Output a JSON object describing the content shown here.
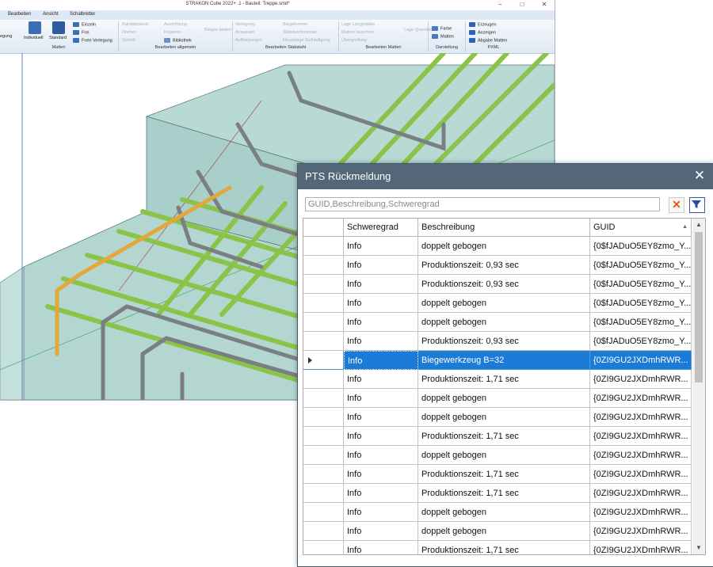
{
  "app": {
    "title": "STRAKON Cube 2022+ .1 - Bauteil: Treppe.smd*",
    "window_controls": [
      "–",
      "□",
      "✕"
    ],
    "ribbon_tabs": [
      "Bearbeiten",
      "Ansicht",
      "Schalbretter"
    ],
    "ribbon_groups": [
      "Matten",
      "Bearbeiten allgemein",
      "Bearbeiten Stabstahl",
      "Bearbeiten Matten",
      "Darstellung",
      "PXML"
    ],
    "ribbon": {
      "matten_big": [
        "Individuell",
        "Standard"
      ],
      "matten_small": [
        "Einzeln",
        "Frei",
        "Freie Verlegung"
      ],
      "allgemein": [
        "Randabstand",
        "Drehen",
        "Schnitt",
        "Ausrichtung",
        "Kopieren",
        "Bibliothek",
        "Biegen ändern"
      ],
      "stabstahl": [
        "Verlegung",
        "Anpassen",
        "Aufbiegungen",
        "Biegeformen",
        "Stabdurchmesser",
        "Neuanlage Gefriedigung"
      ],
      "matten_edit": [
        "Lage Längsstäbe",
        "Matten tauschen",
        "Übergreifung",
        "Lage Querstäbe"
      ],
      "darstellung": [
        "Farbe",
        "Matten"
      ],
      "pxml": [
        "Erzeugen",
        "Anzeigen",
        "Abgabe Matten"
      ],
      "cut_label": "egung"
    },
    "colors": {
      "ribbon_accent": "#dfe9f5",
      "concrete": "#a9cfcb",
      "bar_green": "#8bc34a",
      "bar_gray": "#7a7f84",
      "bar_orange": "#e3a83b"
    }
  },
  "dialog": {
    "title": "PTS Rückmeldung",
    "close_icon": "✕",
    "filter": {
      "value": "GUID,Beschreibung,Schweregrad"
    },
    "columns": [
      "",
      "Schweregrad",
      "Beschreibung",
      "GUID"
    ],
    "rows": [
      {
        "severity": "Info",
        "description": "doppelt gebogen",
        "guid": "{0$fJADuO5EY8zmo_Y..."
      },
      {
        "severity": "Info",
        "description": "Produktionszeit: 0,93 sec",
        "guid": "{0$fJADuO5EY8zmo_Y..."
      },
      {
        "severity": "Info",
        "description": "Produktionszeit: 0,93 sec",
        "guid": "{0$fJADuO5EY8zmo_Y..."
      },
      {
        "severity": "Info",
        "description": "doppelt gebogen",
        "guid": "{0$fJADuO5EY8zmo_Y..."
      },
      {
        "severity": "Info",
        "description": "doppelt gebogen",
        "guid": "{0$fJADuO5EY8zmo_Y..."
      },
      {
        "severity": "Info",
        "description": "Produktionszeit: 0,93 sec",
        "guid": "{0$fJADuO5EY8zmo_Y..."
      },
      {
        "severity": "Info",
        "description": "Biegewerkzeug B=32",
        "guid": "{0ZI9GU2JXDmhRWR...",
        "selected": true
      },
      {
        "severity": "Info",
        "description": "Produktionszeit: 1,71 sec",
        "guid": "{0ZI9GU2JXDmhRWR..."
      },
      {
        "severity": "Info",
        "description": "doppelt gebogen",
        "guid": "{0ZI9GU2JXDmhRWR..."
      },
      {
        "severity": "Info",
        "description": "doppelt gebogen",
        "guid": "{0ZI9GU2JXDmhRWR..."
      },
      {
        "severity": "Info",
        "description": "Produktionszeit: 1,71 sec",
        "guid": "{0ZI9GU2JXDmhRWR..."
      },
      {
        "severity": "Info",
        "description": "doppelt gebogen",
        "guid": "{0ZI9GU2JXDmhRWR..."
      },
      {
        "severity": "Info",
        "description": "Produktionszeit: 1,71 sec",
        "guid": "{0ZI9GU2JXDmhRWR..."
      },
      {
        "severity": "Info",
        "description": "Produktionszeit: 1,71 sec",
        "guid": "{0ZI9GU2JXDmhRWR..."
      },
      {
        "severity": "Info",
        "description": "doppelt gebogen",
        "guid": "{0ZI9GU2JXDmhRWR..."
      },
      {
        "severity": "Info",
        "description": "doppelt gebogen",
        "guid": "{0ZI9GU2JXDmhRWR..."
      },
      {
        "severity": "Info",
        "description": "Produktionszeit: 1,71 sec",
        "guid": "{0ZI9GU2JXDmhRWR..."
      }
    ],
    "colors": {
      "header": "#546778",
      "selection": "#1c7bd6",
      "clear_icon": "#e85b0c",
      "filter_icon": "#1f4fb0"
    },
    "icons": {
      "clear": "clear-filter-icon",
      "filter": "funnel-icon",
      "sort": "sort-ascending-icon",
      "row_indicator": "current-row-arrow-icon"
    },
    "sort_icon": "▲"
  }
}
